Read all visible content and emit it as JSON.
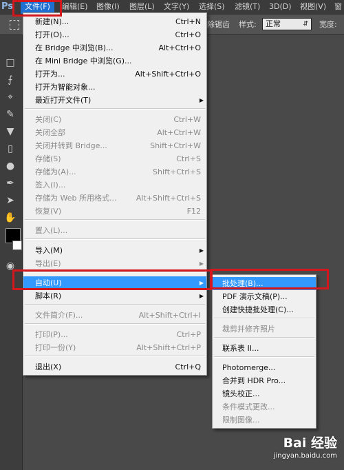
{
  "app": {
    "logo_text": "Ps"
  },
  "menubar": {
    "items": [
      {
        "label": "文件(F)"
      },
      {
        "label": "编辑(E)"
      },
      {
        "label": "图像(I)"
      },
      {
        "label": "图层(L)"
      },
      {
        "label": "文字(Y)"
      },
      {
        "label": "选择(S)"
      },
      {
        "label": "滤镜(T)"
      },
      {
        "label": "3D(D)"
      },
      {
        "label": "视图(V)"
      },
      {
        "label": "窗"
      }
    ]
  },
  "options_bar": {
    "partial_text": "消除锯齿",
    "style_label": "样式:",
    "style_value": "正常",
    "width_label": "宽度:"
  },
  "file_menu": {
    "items": [
      {
        "label": "新建(N)...",
        "shortcut": "Ctrl+N"
      },
      {
        "label": "打开(O)...",
        "shortcut": "Ctrl+O"
      },
      {
        "label": "在 Bridge 中浏览(B)...",
        "shortcut": "Alt+Ctrl+O"
      },
      {
        "label": "在 Mini Bridge 中浏览(G)...",
        "shortcut": ""
      },
      {
        "label": "打开为...",
        "shortcut": "Alt+Shift+Ctrl+O"
      },
      {
        "label": "打开为智能对象...",
        "shortcut": ""
      },
      {
        "label": "最近打开文件(T)",
        "shortcut": ""
      },
      {
        "label": "关闭(C)",
        "shortcut": "Ctrl+W"
      },
      {
        "label": "关闭全部",
        "shortcut": "Alt+Ctrl+W"
      },
      {
        "label": "关闭并转到 Bridge...",
        "shortcut": "Shift+Ctrl+W"
      },
      {
        "label": "存储(S)",
        "shortcut": "Ctrl+S"
      },
      {
        "label": "存储为(A)...",
        "shortcut": "Shift+Ctrl+S"
      },
      {
        "label": "签入(I)...",
        "shortcut": ""
      },
      {
        "label": "存储为 Web 所用格式...",
        "shortcut": "Alt+Shift+Ctrl+S"
      },
      {
        "label": "恢复(V)",
        "shortcut": "F12"
      },
      {
        "label": "置入(L)...",
        "shortcut": ""
      },
      {
        "label": "导入(M)",
        "shortcut": ""
      },
      {
        "label": "导出(E)",
        "shortcut": ""
      },
      {
        "label": "自动(U)",
        "shortcut": ""
      },
      {
        "label": "脚本(R)",
        "shortcut": ""
      },
      {
        "label": "文件简介(F)...",
        "shortcut": "Alt+Shift+Ctrl+I"
      },
      {
        "label": "打印(P)...",
        "shortcut": "Ctrl+P"
      },
      {
        "label": "打印一份(Y)",
        "shortcut": "Alt+Shift+Ctrl+P"
      },
      {
        "label": "退出(X)",
        "shortcut": "Ctrl+Q"
      }
    ]
  },
  "auto_submenu": {
    "items": [
      {
        "label": "批处理(B)..."
      },
      {
        "label": "PDF 演示文稿(P)..."
      },
      {
        "label": "创建快捷批处理(C)..."
      },
      {
        "label": "裁剪并修齐照片"
      },
      {
        "label": "联系表 II..."
      },
      {
        "label": "Photomerge..."
      },
      {
        "label": "合并到 HDR Pro..."
      },
      {
        "label": "镜头校正..."
      },
      {
        "label": "条件模式更改..."
      },
      {
        "label": "限制图像..."
      }
    ]
  },
  "watermark": {
    "logo_text": "Bai 经验",
    "url": "jingyan.baidu.com"
  }
}
